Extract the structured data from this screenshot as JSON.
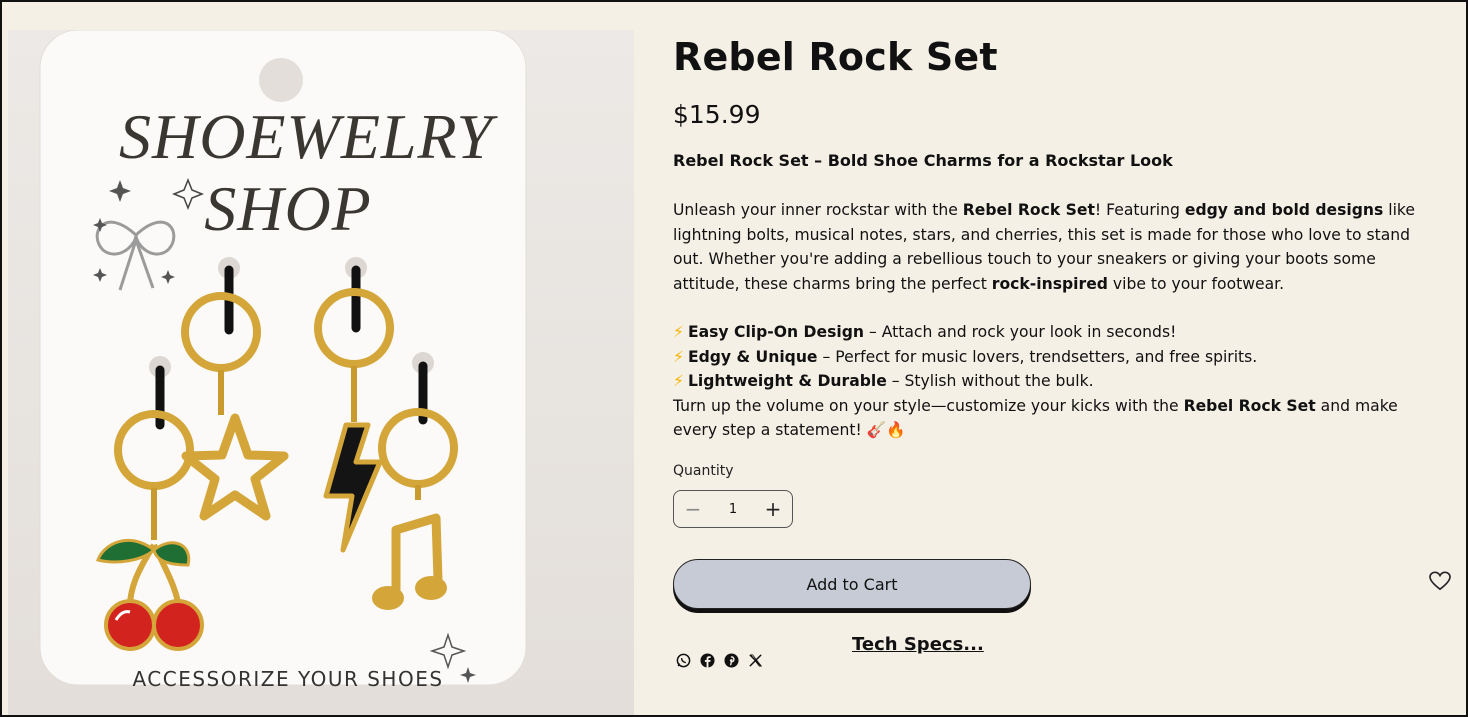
{
  "product": {
    "title": "Rebel Rock Set",
    "price": "$15.99",
    "subhead": "Rebel Rock Set – Bold Shoe Charms for a Rockstar Look",
    "description": {
      "p1_a": "Unleash your inner rockstar with the ",
      "p1_b": "Rebel Rock Set",
      "p1_c": "! Featuring ",
      "p1_d": "edgy and bold designs",
      "p1_e": " like lightning bolts, musical notes, stars, and cherries, this set is made for those who love to stand out. Whether you're adding a rebellious touch to your sneakers or giving your boots some attitude, these charms bring the perfect ",
      "p1_f": "rock-inspired",
      "p1_g": " vibe to your footwear."
    },
    "features": [
      {
        "icon": "⚡",
        "title": "Easy Clip-On Design",
        "text": " – Attach and rock your look in seconds!"
      },
      {
        "icon": "⚡",
        "title": "Edgy & Unique",
        "text": " – Perfect for music lovers, trendsetters, and free spirits."
      },
      {
        "icon": "⚡",
        "title": "Lightweight & Durable",
        "text": " – Stylish without the bulk."
      }
    ],
    "closing": {
      "a": "Turn up the volume on your style—customize your kicks with the ",
      "b": "Rebel Rock Set",
      "c": " and make every step a statement! 🎸🔥"
    }
  },
  "purchase": {
    "quantity_label": "Quantity",
    "quantity_value": "1",
    "minus_label": "−",
    "plus_label": "+",
    "add_to_cart_label": "Add to Cart",
    "wishlist_icon": "heart-icon"
  },
  "links": {
    "tech_specs": "Tech Specs..."
  },
  "social": [
    "whatsapp-icon",
    "facebook-icon",
    "pinterest-icon",
    "x-icon"
  ],
  "image": {
    "brand_line1": "SHOEWELRY",
    "brand_line2": "SHOP",
    "tagline": "ACCESSORIZE YOUR SHOES"
  },
  "colors": {
    "page_bg": "#f5f0e6",
    "cart_button": "#c7cbd6",
    "gold": "#d4a63a",
    "cherry": "#d3231f",
    "leaf": "#1f6e34"
  }
}
